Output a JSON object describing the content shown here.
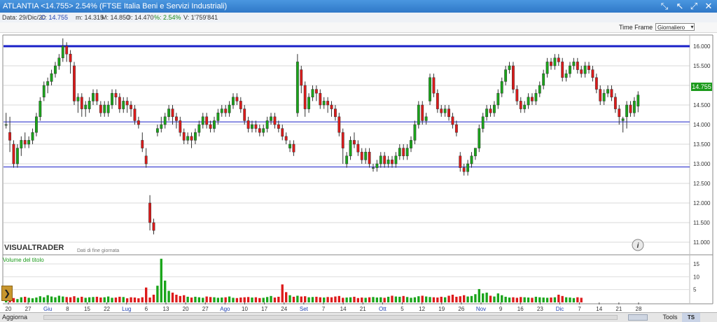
{
  "titlebar": {
    "title": "ATLANTIA <14.755> 2.54%  (FTSE Italia Beni e Servizi Industriali)"
  },
  "infobar": {
    "date": "Data: 29/Dic/20",
    "close": "C: 14.755",
    "min": "m: 14.315",
    "max": "M: 14.850",
    "open": "O: 14.470",
    "pct": "%: 2.54%",
    "volume": "V: 1'759'841"
  },
  "timeframe": {
    "label": "Time Frame",
    "selected": "Giornaliero"
  },
  "bottombar": {
    "aggiorna": "Aggiorna",
    "tools": "Tools",
    "tsoff": "TS OFF"
  },
  "chart_data": [
    {
      "type": "candlestick",
      "ylim": [
        10.75,
        16.25
      ],
      "y_ticks": [
        "11.000",
        "11.500",
        "12.000",
        "12.500",
        "13.000",
        "13.500",
        "14.000",
        "14.500",
        "15.000",
        "15.500",
        "16.000"
      ],
      "price_tag": "14.755",
      "horizontal_lines": [
        16.0,
        14.07,
        12.92
      ],
      "watermark": "VISUALTRADER",
      "watermark_sub": "Dati di fine giornata",
      "x_labels": [
        "20",
        "27",
        "Giu",
        "8",
        "15",
        "22",
        "Lug",
        "6",
        "13",
        "20",
        "27",
        "Ago",
        "10",
        "17",
        "24",
        "Set",
        "7",
        "14",
        "21",
        "Ott",
        "5",
        "12",
        "19",
        "26",
        "Nov",
        "9",
        "16",
        "23",
        "Dic",
        "7",
        "14",
        "21",
        "28"
      ],
      "candles": [
        [
          14.0,
          14.0,
          14.3,
          13.9
        ],
        [
          13.8,
          13.6,
          14.2,
          13.3
        ],
        [
          13.5,
          13.0,
          13.6,
          12.9
        ],
        [
          13.0,
          13.4,
          13.5,
          12.9
        ],
        [
          13.4,
          13.6,
          13.7,
          13.2
        ],
        [
          13.6,
          13.5,
          13.8,
          13.4
        ],
        [
          13.5,
          13.6,
          13.7,
          13.4
        ],
        [
          13.6,
          13.8,
          13.9,
          13.5
        ],
        [
          13.8,
          14.2,
          14.3,
          13.7
        ],
        [
          14.2,
          14.6,
          14.7,
          14.1
        ],
        [
          14.7,
          15.0,
          15.1,
          14.6
        ],
        [
          15.0,
          15.1,
          15.2,
          14.8
        ],
        [
          15.1,
          15.3,
          15.4,
          15.0
        ],
        [
          15.3,
          15.5,
          15.6,
          15.2
        ],
        [
          15.5,
          15.7,
          15.8,
          15.4
        ],
        [
          15.7,
          16.0,
          16.2,
          15.6
        ],
        [
          16.0,
          15.8,
          16.1,
          15.6
        ],
        [
          15.8,
          15.6,
          15.9,
          15.3
        ],
        [
          15.5,
          14.6,
          15.6,
          14.5
        ],
        [
          14.6,
          14.7,
          14.8,
          14.3
        ],
        [
          14.7,
          14.4,
          14.8,
          14.2
        ],
        [
          14.4,
          14.5,
          14.6,
          14.2
        ],
        [
          14.4,
          14.6,
          14.7,
          14.3
        ],
        [
          14.6,
          14.8,
          14.9,
          14.5
        ],
        [
          14.8,
          14.6,
          14.9,
          14.5
        ],
        [
          14.5,
          14.3,
          14.6,
          14.2
        ],
        [
          14.3,
          14.5,
          14.6,
          14.2
        ],
        [
          14.3,
          14.5,
          14.6,
          14.2
        ],
        [
          14.5,
          14.8,
          14.9,
          14.4
        ],
        [
          14.8,
          14.7,
          14.9,
          14.5
        ],
        [
          14.7,
          14.4,
          14.8,
          14.3
        ],
        [
          14.4,
          14.6,
          14.7,
          14.3
        ],
        [
          14.6,
          14.5,
          14.7,
          14.3
        ],
        [
          14.5,
          14.4,
          14.6,
          14.2
        ],
        [
          14.4,
          14.1,
          14.5,
          14.0
        ],
        [
          14.1,
          14.0,
          14.2,
          13.9
        ],
        [
          13.6,
          13.4,
          13.8,
          13.3
        ],
        [
          13.2,
          13.0,
          13.4,
          12.9
        ],
        [
          12.0,
          11.5,
          12.2,
          11.3
        ],
        [
          11.5,
          11.3,
          11.6,
          11.2
        ],
        [
          13.8,
          13.9,
          14.0,
          13.7
        ],
        [
          13.9,
          14.0,
          14.2,
          13.8
        ],
        [
          14.0,
          14.2,
          14.3,
          13.9
        ],
        [
          14.2,
          14.4,
          14.5,
          14.1
        ],
        [
          14.4,
          14.2,
          14.5,
          14.0
        ],
        [
          14.2,
          14.1,
          14.3,
          13.9
        ],
        [
          14.1,
          13.8,
          14.2,
          13.7
        ],
        [
          13.8,
          13.6,
          13.9,
          13.5
        ],
        [
          13.6,
          13.7,
          13.8,
          13.5
        ],
        [
          13.7,
          13.6,
          13.8,
          13.4
        ],
        [
          13.6,
          13.8,
          13.9,
          13.5
        ],
        [
          13.8,
          14.0,
          14.1,
          13.7
        ],
        [
          14.0,
          14.2,
          14.3,
          13.9
        ],
        [
          14.2,
          14.0,
          14.3,
          13.9
        ],
        [
          14.0,
          13.9,
          14.1,
          13.8
        ],
        [
          13.9,
          14.1,
          14.2,
          13.8
        ],
        [
          14.1,
          14.3,
          14.4,
          14.0
        ],
        [
          14.3,
          14.4,
          14.5,
          14.2
        ],
        [
          14.4,
          14.3,
          14.5,
          14.2
        ],
        [
          14.3,
          14.5,
          14.6,
          14.2
        ],
        [
          14.5,
          14.7,
          14.8,
          14.4
        ],
        [
          14.7,
          14.6,
          14.8,
          14.5
        ],
        [
          14.6,
          14.4,
          14.7,
          14.3
        ],
        [
          14.4,
          14.1,
          14.5,
          14.0
        ],
        [
          14.1,
          13.9,
          14.2,
          13.8
        ],
        [
          13.9,
          14.0,
          14.1,
          13.8
        ],
        [
          14.0,
          13.9,
          14.1,
          13.8
        ],
        [
          13.9,
          13.8,
          14.0,
          13.7
        ],
        [
          13.8,
          13.9,
          14.0,
          13.7
        ],
        [
          13.9,
          14.1,
          14.2,
          13.8
        ],
        [
          14.1,
          14.2,
          14.3,
          14.0
        ],
        [
          14.2,
          14.0,
          14.3,
          13.9
        ],
        [
          14.0,
          13.9,
          14.1,
          13.8
        ],
        [
          13.9,
          13.7,
          14.0,
          13.6
        ],
        [
          13.7,
          13.6,
          13.8,
          13.5
        ],
        [
          13.4,
          13.5,
          13.6,
          13.3
        ],
        [
          13.5,
          13.3,
          13.6,
          13.2
        ],
        [
          14.3,
          15.6,
          15.8,
          14.2
        ],
        [
          15.4,
          15.0,
          15.5,
          14.8
        ],
        [
          15.0,
          14.4,
          15.1,
          14.2
        ],
        [
          14.4,
          14.7,
          14.8,
          14.3
        ],
        [
          14.7,
          14.9,
          15.0,
          14.6
        ],
        [
          14.9,
          14.8,
          15.0,
          14.6
        ],
        [
          14.8,
          14.5,
          14.9,
          14.4
        ],
        [
          14.5,
          14.6,
          14.7,
          14.4
        ],
        [
          14.6,
          14.5,
          14.7,
          14.3
        ],
        [
          14.5,
          14.4,
          14.6,
          14.2
        ],
        [
          14.4,
          14.2,
          14.5,
          14.1
        ],
        [
          14.2,
          13.8,
          14.3,
          13.7
        ],
        [
          13.8,
          13.4,
          13.9,
          13.0
        ],
        [
          13.0,
          13.2,
          13.3,
          12.9
        ],
        [
          13.2,
          13.6,
          13.7,
          13.1
        ],
        [
          13.6,
          13.5,
          13.8,
          13.4
        ],
        [
          13.5,
          13.3,
          13.6,
          13.2
        ],
        [
          13.3,
          13.1,
          13.4,
          13.0
        ],
        [
          13.1,
          13.3,
          13.4,
          13.0
        ],
        [
          13.3,
          13.0,
          13.4,
          12.9
        ],
        [
          12.9,
          12.9,
          13.0,
          12.8
        ],
        [
          12.9,
          13.0,
          13.1,
          12.8
        ],
        [
          13.0,
          13.2,
          13.3,
          12.9
        ],
        [
          13.2,
          13.0,
          13.3,
          12.9
        ],
        [
          13.0,
          13.1,
          13.2,
          12.9
        ],
        [
          13.1,
          13.0,
          13.2,
          12.9
        ],
        [
          13.0,
          13.2,
          13.3,
          12.9
        ],
        [
          13.2,
          13.4,
          13.5,
          13.1
        ],
        [
          13.4,
          13.2,
          13.5,
          13.1
        ],
        [
          13.2,
          13.4,
          13.5,
          13.1
        ],
        [
          13.4,
          13.6,
          13.7,
          13.3
        ],
        [
          13.6,
          14.0,
          14.1,
          13.5
        ],
        [
          14.0,
          14.5,
          14.6,
          13.9
        ],
        [
          14.5,
          14.1,
          14.6,
          14.0
        ],
        [
          14.1,
          14.2,
          14.3,
          14.0
        ],
        [
          14.6,
          15.2,
          15.3,
          14.5
        ],
        [
          15.2,
          14.8,
          15.3,
          14.7
        ],
        [
          14.8,
          14.4,
          14.9,
          14.3
        ],
        [
          14.4,
          14.3,
          14.5,
          14.2
        ],
        [
          14.3,
          14.4,
          14.5,
          14.2
        ],
        [
          14.4,
          14.2,
          14.5,
          14.1
        ],
        [
          14.2,
          14.0,
          14.3,
          13.9
        ],
        [
          14.0,
          13.8,
          14.1,
          13.7
        ],
        [
          13.2,
          12.9,
          13.3,
          12.8
        ],
        [
          12.9,
          12.8,
          13.0,
          12.7
        ],
        [
          12.8,
          13.0,
          13.1,
          12.7
        ],
        [
          13.0,
          13.2,
          13.3,
          12.9
        ],
        [
          13.2,
          13.4,
          13.3,
          13.1
        ],
        [
          13.4,
          13.9,
          14.0,
          13.3
        ],
        [
          13.9,
          14.2,
          14.3,
          13.8
        ],
        [
          14.2,
          14.4,
          14.5,
          14.1
        ],
        [
          14.4,
          14.3,
          14.5,
          14.2
        ],
        [
          14.3,
          14.5,
          14.6,
          14.2
        ],
        [
          14.5,
          14.8,
          14.9,
          14.4
        ],
        [
          14.8,
          15.1,
          15.2,
          14.7
        ],
        [
          15.1,
          15.4,
          15.5,
          15.0
        ],
        [
          15.4,
          15.5,
          15.6,
          15.3
        ],
        [
          15.5,
          14.9,
          15.6,
          14.8
        ],
        [
          14.9,
          14.6,
          15.0,
          14.5
        ],
        [
          14.6,
          14.4,
          14.7,
          14.3
        ],
        [
          14.4,
          14.5,
          14.6,
          14.3
        ],
        [
          14.5,
          14.7,
          14.8,
          14.4
        ],
        [
          14.7,
          14.6,
          14.8,
          14.5
        ],
        [
          14.6,
          14.8,
          14.9,
          14.5
        ],
        [
          14.8,
          15.0,
          15.1,
          14.7
        ],
        [
          15.0,
          15.3,
          15.4,
          14.9
        ],
        [
          15.3,
          15.6,
          15.7,
          15.2
        ],
        [
          15.6,
          15.5,
          15.7,
          15.4
        ],
        [
          15.5,
          15.7,
          15.8,
          15.4
        ],
        [
          15.7,
          15.6,
          15.8,
          15.5
        ],
        [
          15.6,
          15.2,
          15.7,
          15.1
        ],
        [
          15.2,
          15.3,
          15.4,
          15.1
        ],
        [
          15.3,
          15.5,
          15.6,
          15.2
        ],
        [
          15.5,
          15.6,
          15.7,
          15.4
        ],
        [
          15.6,
          15.4,
          15.7,
          15.3
        ],
        [
          15.4,
          15.3,
          15.5,
          15.2
        ],
        [
          15.3,
          15.5,
          15.6,
          15.2
        ],
        [
          15.5,
          15.4,
          15.6,
          15.3
        ],
        [
          15.4,
          15.2,
          15.5,
          15.1
        ],
        [
          15.2,
          14.9,
          15.3,
          14.8
        ],
        [
          14.9,
          14.6,
          15.0,
          14.5
        ],
        [
          14.6,
          14.8,
          14.9,
          14.5
        ],
        [
          14.8,
          14.9,
          15.0,
          14.7
        ],
        [
          14.9,
          14.7,
          15.0,
          14.6
        ],
        [
          14.7,
          14.4,
          14.8,
          14.3
        ],
        [
          14.4,
          14.2,
          14.5,
          14.0
        ],
        [
          14.1,
          14.15,
          14.2,
          13.8
        ],
        [
          14.2,
          14.5,
          14.6,
          13.9
        ],
        [
          14.5,
          14.3,
          14.6,
          14.2
        ],
        [
          14.3,
          14.6,
          14.7,
          14.2
        ],
        [
          14.47,
          14.755,
          14.85,
          14.315
        ]
      ]
    },
    {
      "type": "bar",
      "series_name": "Volume del titolo",
      "ylim": [
        0,
        18
      ],
      "y_ticks": [
        "5",
        "10",
        "15"
      ],
      "values": [
        1.5,
        1.4,
        1.7,
        1.3,
        2.0,
        2.2,
        1.8,
        1.6,
        1.9,
        2.4,
        2.0,
        2.8,
        2.3,
        2.0,
        2.6,
        2.3,
        2.1,
        2.0,
        2.4,
        1.8,
        2.2,
        1.8,
        2.0,
        2.1,
        2.2,
        1.9,
        2.0,
        2.3,
        1.8,
        1.9,
        2.2,
        2.1,
        1.6,
        2.0,
        1.9,
        1.6,
        2.0,
        5.8,
        1.9,
        3.0,
        6.5,
        17.0,
        8.5,
        4.5,
        3.8,
        3.0,
        2.5,
        2.8,
        2.2,
        1.9,
        2.2,
        2.0,
        1.8,
        2.3,
        2.1,
        2.0,
        1.8,
        1.9,
        2.0,
        2.3,
        1.8,
        1.7,
        1.9,
        2.0,
        2.1,
        1.9,
        2.0,
        1.7,
        1.8,
        2.1,
        2.5,
        1.9,
        2.2,
        7.0,
        4.0,
        2.8,
        2.2,
        2.6,
        2.3,
        2.4,
        2.0,
        2.1,
        2.2,
        2.0,
        1.9,
        2.1,
        2.0,
        2.3,
        2.5,
        1.8,
        1.9,
        2.0,
        2.2,
        1.7,
        1.9,
        1.8,
        2.0,
        2.1,
        1.9,
        2.0,
        1.8,
        2.2,
        2.6,
        2.3,
        2.2,
        2.5,
        2.1,
        1.8,
        2.0,
        2.4,
        2.6,
        2.3,
        2.1,
        2.0,
        1.9,
        2.2,
        2.0,
        2.6,
        3.0,
        2.2,
        2.4,
        2.8,
        2.3,
        2.5,
        3.2,
        5.2,
        3.5,
        3.8,
        2.6,
        2.3,
        3.5,
        2.8,
        2.2,
        1.9,
        2.0,
        1.8,
        2.1,
        2.0,
        1.9,
        1.8,
        2.2,
        2.0,
        1.9,
        1.8,
        1.9,
        2.0,
        3.0,
        2.5,
        2.0,
        1.9,
        1.7,
        2.0,
        1.8
      ]
    }
  ]
}
